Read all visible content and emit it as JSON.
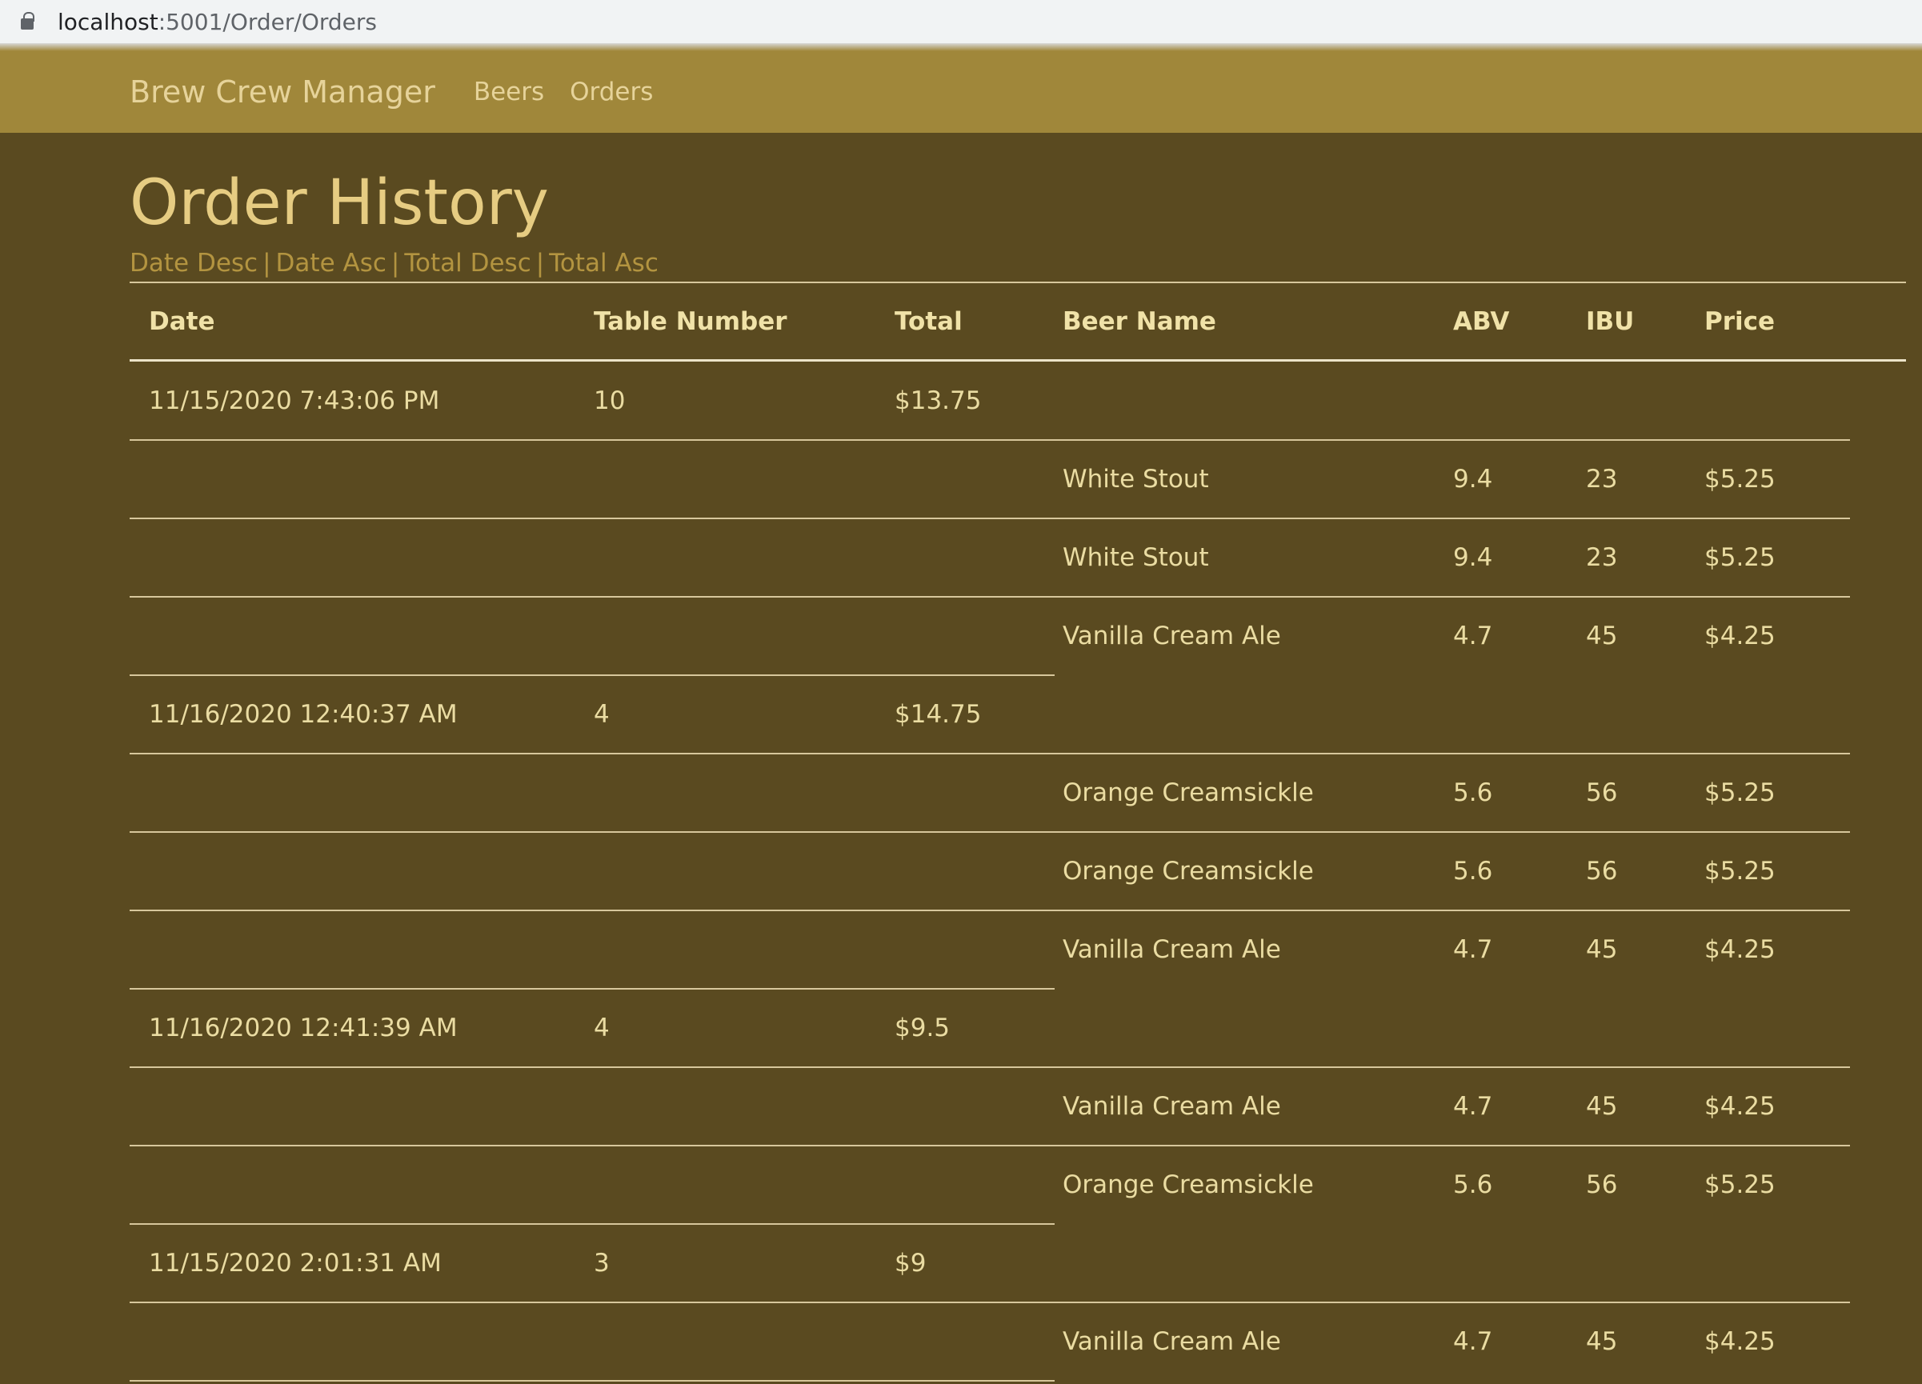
{
  "browser": {
    "host": "localhost",
    "path": ":5001/Order/Orders"
  },
  "nav": {
    "brand": "Brew Crew Manager",
    "links": [
      "Beers",
      "Orders"
    ]
  },
  "page": {
    "title": "Order History",
    "sort_links": [
      "Date Desc",
      "Date Asc",
      "Total Desc",
      "Total Asc"
    ],
    "separator": "|"
  },
  "table": {
    "headers": {
      "date": "Date",
      "table_number": "Table Number",
      "total": "Total",
      "beer_name": "Beer Name",
      "abv": "ABV",
      "ibu": "IBU",
      "price": "Price"
    },
    "orders": [
      {
        "date": "11/15/2020 7:43:06 PM",
        "table_number": "10",
        "total": "$13.75",
        "items": [
          {
            "beer": "White Stout",
            "abv": "9.4",
            "ibu": "23",
            "price": "$5.25"
          },
          {
            "beer": "White Stout",
            "abv": "9.4",
            "ibu": "23",
            "price": "$5.25"
          },
          {
            "beer": "Vanilla Cream Ale",
            "abv": "4.7",
            "ibu": "45",
            "price": "$4.25"
          }
        ]
      },
      {
        "date": "11/16/2020 12:40:37 AM",
        "table_number": "4",
        "total": "$14.75",
        "items": [
          {
            "beer": "Orange Creamsickle",
            "abv": "5.6",
            "ibu": "56",
            "price": "$5.25"
          },
          {
            "beer": "Orange Creamsickle",
            "abv": "5.6",
            "ibu": "56",
            "price": "$5.25"
          },
          {
            "beer": "Vanilla Cream Ale",
            "abv": "4.7",
            "ibu": "45",
            "price": "$4.25"
          }
        ]
      },
      {
        "date": "11/16/2020 12:41:39 AM",
        "table_number": "4",
        "total": "$9.5",
        "items": [
          {
            "beer": "Vanilla Cream Ale",
            "abv": "4.7",
            "ibu": "45",
            "price": "$4.25"
          },
          {
            "beer": "Orange Creamsickle",
            "abv": "5.6",
            "ibu": "56",
            "price": "$5.25"
          }
        ]
      },
      {
        "date": "11/15/2020 2:01:31 AM",
        "table_number": "3",
        "total": "$9",
        "items": [
          {
            "beer": "Vanilla Cream Ale",
            "abv": "4.7",
            "ibu": "45",
            "price": "$4.25"
          }
        ]
      }
    ]
  },
  "colors": {
    "background": "#5a4a20",
    "navbar": "#a0873a",
    "title": "#e6cc82",
    "link": "#b39440"
  }
}
